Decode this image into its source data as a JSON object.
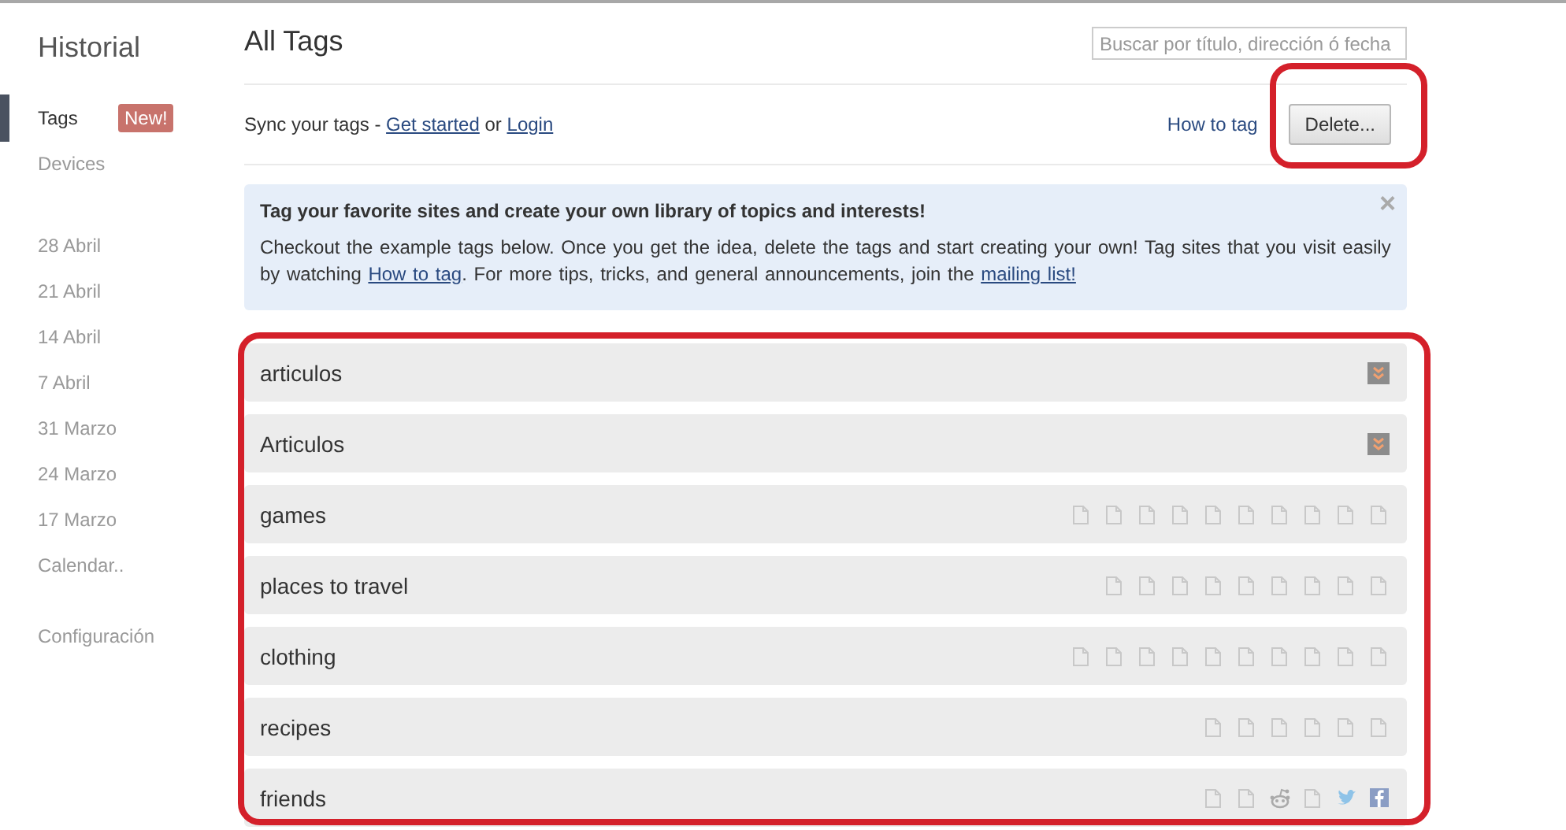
{
  "sidebar": {
    "title": "Historial",
    "items": [
      {
        "label": "Tags",
        "badge": "New!",
        "selected": true
      },
      {
        "label": "Devices",
        "selected": false
      }
    ],
    "dates": [
      "28 Abril",
      "21 Abril",
      "14 Abril",
      "7 Abril",
      "31 Marzo",
      "24 Marzo",
      "17 Marzo",
      "Calendar.."
    ],
    "settings": "Configuración"
  },
  "main": {
    "title": "All Tags",
    "search": {
      "placeholder": "Buscar por título, dirección ó fecha"
    },
    "sync": {
      "text": "Sync your tags - ",
      "link1": "Get started",
      "middle": " or ",
      "link2": "Login"
    },
    "how_to": "How to tag",
    "delete_button": {
      "label": "Delete...",
      "highlighted": true
    },
    "banner": {
      "heading": "Tag your favorite sites and create your own library of topics and interests!",
      "body_parts": [
        {
          "kind": "text",
          "text": "Checkout the example tags below. Once you get the idea, delete the tags and start creating your own! Tag sites that you visit easily by watching "
        },
        {
          "kind": "link",
          "text": "How to tag"
        },
        {
          "kind": "text",
          "text": ". For more tips, tricks, and general announcements, join the "
        },
        {
          "kind": "link",
          "text": "mailing list!"
        }
      ],
      "close": "×"
    },
    "tag_list": {
      "highlighted": true,
      "tags": [
        {
          "name": "articulos",
          "kind": "expand"
        },
        {
          "name": "Articulos",
          "kind": "expand"
        },
        {
          "name": "games",
          "kind": "pages",
          "icons": [
            {
              "kind": "page"
            },
            {
              "kind": "page"
            },
            {
              "kind": "page"
            },
            {
              "kind": "page"
            },
            {
              "kind": "page"
            },
            {
              "kind": "page"
            },
            {
              "kind": "page"
            },
            {
              "kind": "page"
            },
            {
              "kind": "page"
            },
            {
              "kind": "page"
            }
          ]
        },
        {
          "name": "places to travel",
          "kind": "pages",
          "icons": [
            {
              "kind": "page"
            },
            {
              "kind": "page"
            },
            {
              "kind": "page"
            },
            {
              "kind": "page"
            },
            {
              "kind": "page"
            },
            {
              "kind": "page"
            },
            {
              "kind": "page"
            },
            {
              "kind": "page"
            },
            {
              "kind": "page"
            }
          ]
        },
        {
          "name": "clothing",
          "kind": "pages",
          "icons": [
            {
              "kind": "page"
            },
            {
              "kind": "page"
            },
            {
              "kind": "page"
            },
            {
              "kind": "page"
            },
            {
              "kind": "page"
            },
            {
              "kind": "page"
            },
            {
              "kind": "page"
            },
            {
              "kind": "page"
            },
            {
              "kind": "page"
            },
            {
              "kind": "page"
            }
          ]
        },
        {
          "name": "recipes",
          "kind": "pages",
          "icons": [
            {
              "kind": "page"
            },
            {
              "kind": "page"
            },
            {
              "kind": "page"
            },
            {
              "kind": "page"
            },
            {
              "kind": "page"
            },
            {
              "kind": "page"
            }
          ]
        },
        {
          "name": "friends",
          "kind": "pages",
          "icons": [
            {
              "kind": "page"
            },
            {
              "kind": "page"
            },
            {
              "kind": "reddit"
            },
            {
              "kind": "page"
            },
            {
              "kind": "twitter"
            },
            {
              "kind": "facebook"
            }
          ]
        }
      ]
    }
  }
}
